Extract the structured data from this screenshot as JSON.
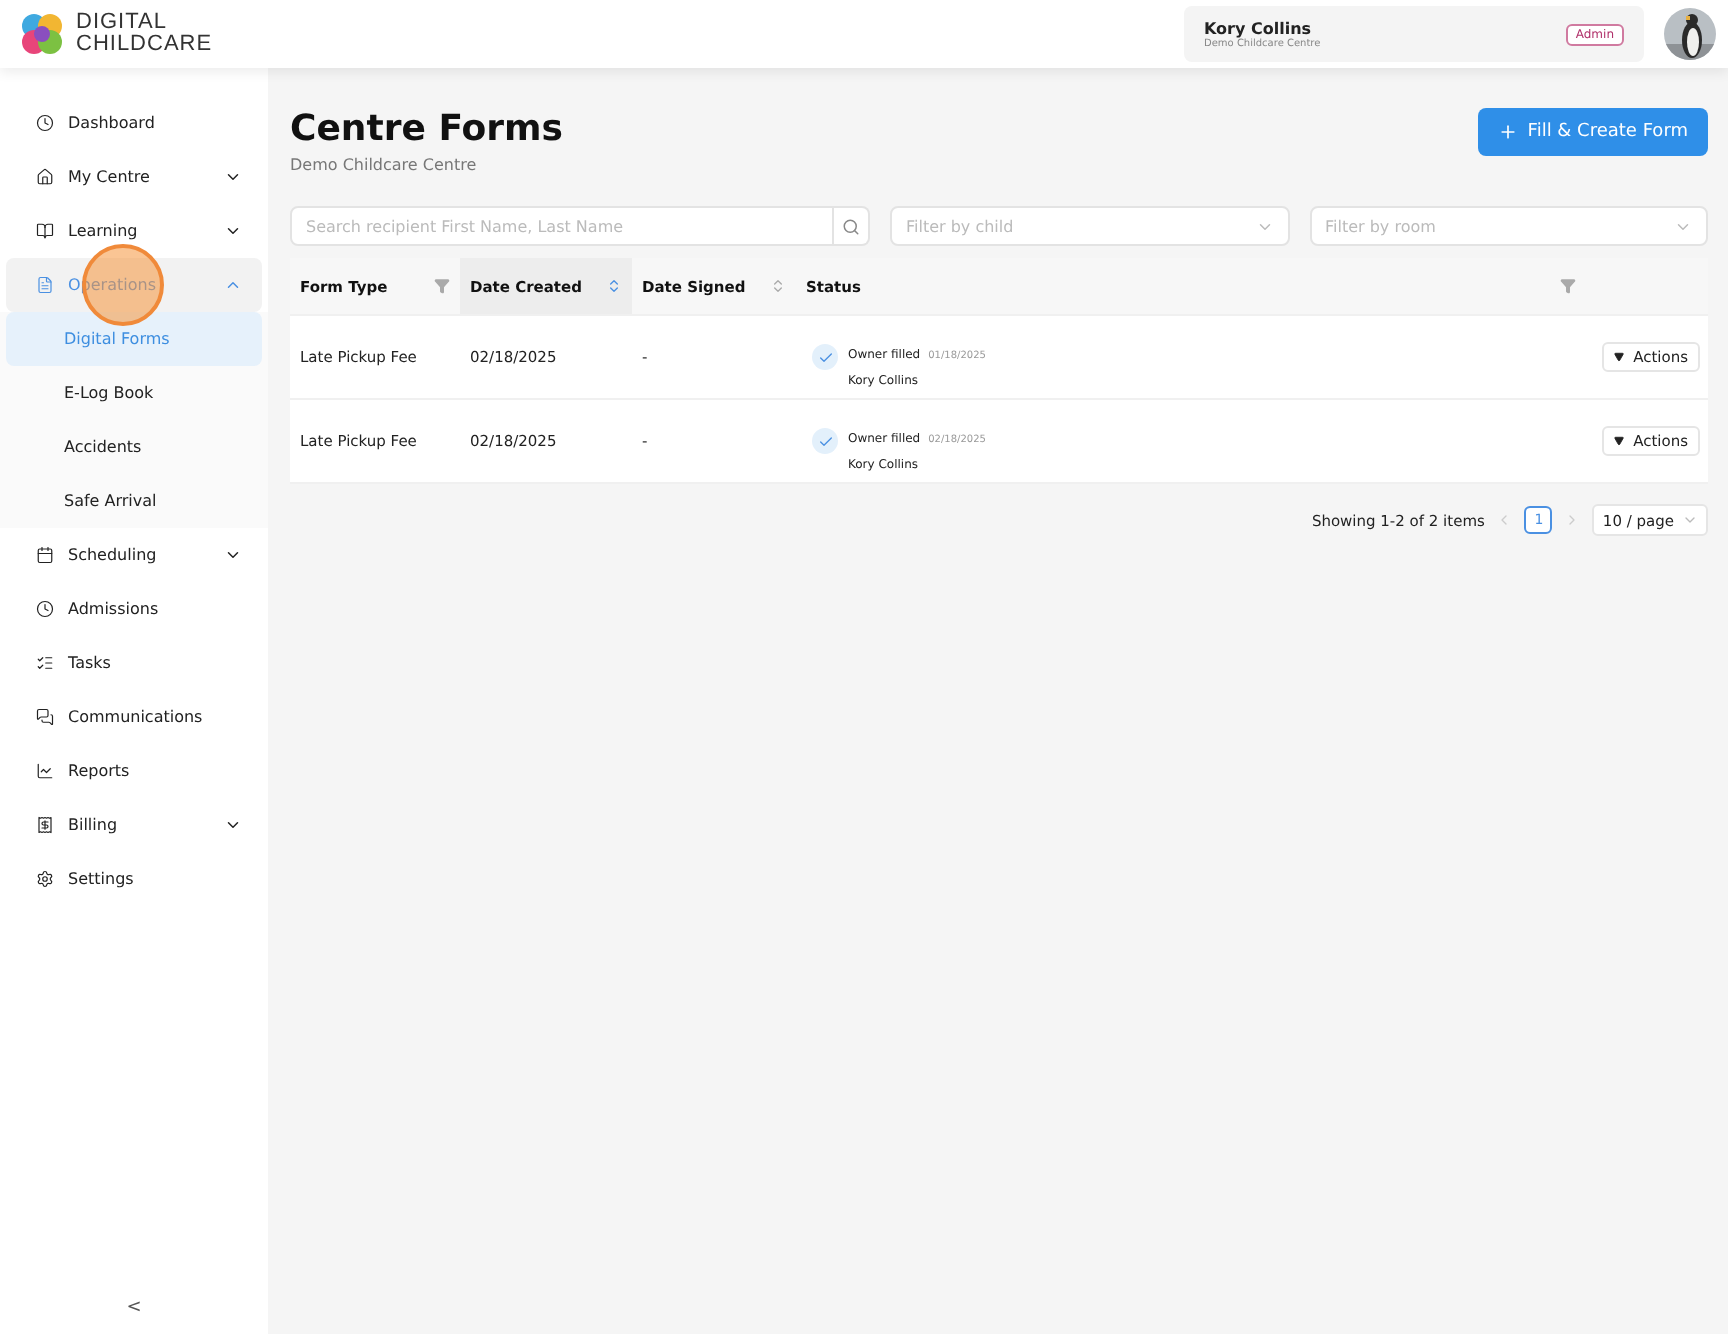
{
  "logo": {
    "line1": "DIGITAL",
    "line2": "CHILDCARE"
  },
  "user": {
    "name": "Kory Collins",
    "centre": "Demo Childcare Centre",
    "role": "Admin"
  },
  "sidebar": {
    "items": [
      {
        "label": "Dashboard",
        "selected": false
      },
      {
        "label": "My Centre",
        "selected": false,
        "expanded": false
      },
      {
        "label": "Learning",
        "selected": false,
        "expanded": false
      },
      {
        "label": "Operations",
        "selected": true,
        "expanded": true,
        "children": [
          {
            "label": "Digital Forms",
            "selected": true
          },
          {
            "label": "E-Log Book",
            "selected": false
          },
          {
            "label": "Accidents",
            "selected": false
          },
          {
            "label": "Safe Arrival",
            "selected": false
          }
        ]
      },
      {
        "label": "Scheduling",
        "selected": false,
        "expanded": false
      },
      {
        "label": "Admissions",
        "selected": false
      },
      {
        "label": "Tasks",
        "selected": false
      },
      {
        "label": "Communications",
        "selected": false
      },
      {
        "label": "Reports",
        "selected": false
      },
      {
        "label": "Billing",
        "selected": false,
        "expanded": false
      },
      {
        "label": "Settings",
        "selected": false
      }
    ],
    "collapse": "<"
  },
  "page": {
    "title": "Centre Forms",
    "subtitle": "Demo Childcare Centre",
    "create_button": "Fill & Create Form"
  },
  "filters": {
    "search": {
      "placeholder": "Search recipient First Name, Last Name"
    },
    "child": {
      "placeholder": "Filter by child"
    },
    "room": {
      "placeholder": "Filter by room"
    }
  },
  "table": {
    "columns": [
      {
        "label": "Form Type",
        "kind": "filter"
      },
      {
        "label": "Date Created",
        "kind": "sort",
        "sorted": true
      },
      {
        "label": "Date Signed",
        "kind": "sort",
        "sorted": false
      },
      {
        "label": "Status",
        "kind": "filter"
      }
    ],
    "rows": [
      {
        "form_type": "Late Pickup Fee",
        "date_created": "02/18/2025",
        "date_signed": "-",
        "status": "Owner filled",
        "status_date": "01/18/2025",
        "signer": "Kory Collins",
        "actions": "Actions"
      },
      {
        "form_type": "Late Pickup Fee",
        "date_created": "02/18/2025",
        "date_signed": "-",
        "status": "Owner filled",
        "status_date": "02/18/2025",
        "signer": "Kory Collins",
        "actions": "Actions"
      }
    ]
  },
  "pagination": {
    "summary": "Showing 1-2 of 2 items",
    "pages": [
      {
        "label": "1",
        "selected": true
      }
    ],
    "page_size": "10 / page"
  }
}
